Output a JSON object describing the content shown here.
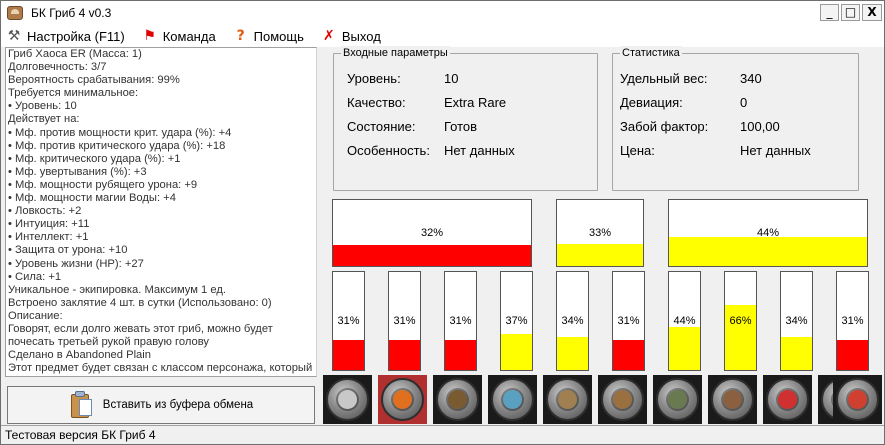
{
  "window": {
    "title": "БК Гриб 4 v0.3",
    "minimize": "_",
    "maximize": "□",
    "close": "X"
  },
  "menu": [
    {
      "label": "Настройка (F11)",
      "icon": "wrench-icon"
    },
    {
      "label": "Команда",
      "icon": "flag-icon"
    },
    {
      "label": "Помощь",
      "icon": "question-icon"
    },
    {
      "label": "Выход",
      "icon": "exit-x-icon"
    }
  ],
  "item_text": [
    "Гриб Хаоса  ER   (Масса: 1)",
    "Долговечность: 3/7",
    "Вероятность срабатывания: 99%",
    "Требуется минимальное:",
    "• Уровень: 10",
    "Действует на:",
    "• Мф. против мощности крит. удара (%): +4",
    "• Мф. против критического удара (%): +18",
    "• Мф. критического удара (%): +1",
    "• Мф. увертывания (%): +3",
    "• Мф. мощности рубящего урона: +9",
    "• Мф. мощности магии Воды: +4",
    "• Ловкость: +2",
    "• Интуиция: +11",
    "• Интеллект: +1",
    "• Защита от урона: +10",
    "• Уровень жизни (HP): +27",
    "• Сила: +1",
    "Уникальное - экипировка. Максимум 1 ед.",
    "Встроено заклятие  4 шт. в сутки (Использовано: 0)",
    "Описание:",
    "Говорят, если долго жевать этот гриб, можно будет",
    "почесать третьей рукой правую голову",
    "Сделано в Abandoned Plain",
    "Этот предмет будет связан с классом персонажа, который"
  ],
  "paste_button": {
    "label": "Вставить из буфера обмена",
    "icon": "clipboard-icon"
  },
  "status": "Тестовая версия БК Гриб 4",
  "input_params": {
    "caption": "Входные параметры",
    "rows": [
      {
        "label": "Уровень:",
        "value": "10"
      },
      {
        "label": "Качество:",
        "value": "Extra Rare"
      },
      {
        "label": "Состояние:",
        "value": "Готов"
      },
      {
        "label": "Особенность:",
        "value": "Нет данных"
      }
    ]
  },
  "stats": {
    "caption": "Статистика",
    "rows": [
      {
        "label": "Удельный вес:",
        "value": "340"
      },
      {
        "label": "Девиация:",
        "value": "0"
      },
      {
        "label": "Забой фактор:",
        "value": "100,00"
      },
      {
        "label": "Цена:",
        "value": "Нет данных"
      }
    ]
  },
  "big_bars": [
    {
      "percent_label": "32%",
      "value": 32,
      "color": "#ff0000"
    },
    {
      "percent_label": "33%",
      "value": 33,
      "color": "#ffff00"
    },
    {
      "percent_label": "44%",
      "value": 44,
      "color": "#ffff00"
    }
  ],
  "small_bars": [
    {
      "percent_label": "31%",
      "value": 31,
      "color": "#ff0000"
    },
    {
      "percent_label": "31%",
      "value": 31,
      "color": "#ff0000"
    },
    {
      "percent_label": "31%",
      "value": 31,
      "color": "#ff0000"
    },
    {
      "percent_label": "37%",
      "value": 37,
      "color": "#ffff00"
    },
    {
      "percent_label": "34%",
      "value": 34,
      "color": "#ffff00"
    },
    {
      "percent_label": "31%",
      "value": 31,
      "color": "#ff0000"
    },
    {
      "percent_label": "44%",
      "value": 44,
      "color": "#ffff00"
    },
    {
      "percent_label": "66%",
      "value": 66,
      "color": "#ffff00"
    },
    {
      "percent_label": "34%",
      "value": 34,
      "color": "#ffff00"
    },
    {
      "percent_label": "31%",
      "value": 31,
      "color": "#ff0000"
    }
  ],
  "item_slots": [
    {
      "icon": "armor-plate-icon",
      "color": "#c8c8c8",
      "selected": false
    },
    {
      "icon": "fire-mushroom-icon",
      "color": "#e07020",
      "selected": true
    },
    {
      "icon": "root-claw-icon",
      "color": "#7a5a30",
      "selected": false
    },
    {
      "icon": "water-lotus-icon",
      "color": "#5aa0c0",
      "selected": false
    },
    {
      "icon": "acorn-icon",
      "color": "#a08050",
      "selected": false
    },
    {
      "icon": "wooden-shield-icon",
      "color": "#9a7040",
      "selected": false
    },
    {
      "icon": "bark-rune-icon",
      "color": "#6a7a50",
      "selected": false
    },
    {
      "icon": "chest-icon",
      "color": "#8a6040",
      "selected": false
    },
    {
      "icon": "red-flower-icon",
      "color": "#d03030",
      "selected": false
    },
    {
      "icon": "clover-icon",
      "color": "#40a030",
      "selected": false
    },
    {
      "icon": "strawberry-icon",
      "color": "#d04030",
      "selected": false
    }
  ]
}
